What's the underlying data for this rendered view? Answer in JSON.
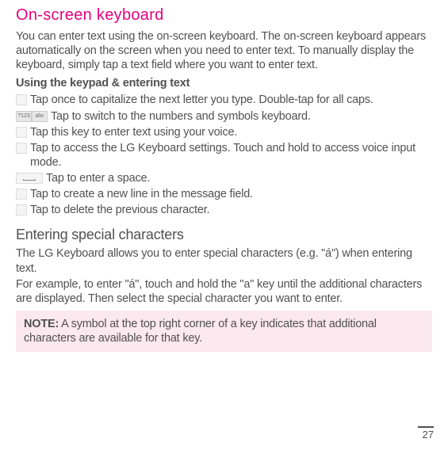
{
  "heading": "On-screen keyboard",
  "intro": "You can enter text using the on-screen keyboard. The on-screen keyboard appears automatically on the screen when you need to enter text. To manually display the keyboard, simply tap a text field where you want to enter text.",
  "subHeading": "Using the keypad & entering text",
  "keys": {
    "caps": " Tap once to capitalize the next letter you type. Double-tap for all caps.",
    "numSym": " Tap to switch to the numbers and symbols keyboard.",
    "voice": " Tap this key to enter text using your voice.",
    "settings": " Tap to access the LG Keyboard settings. Touch and hold to access voice input mode.",
    "space": " Tap to enter a space.",
    "newline": " Tap to create a new line in the message field.",
    "delete": " Tap to delete the previous character."
  },
  "numSymLabels": {
    "left": "?123",
    "right": "abc"
  },
  "section2": {
    "heading": "Entering special characters",
    "p1": "The LG Keyboard allows you to enter special characters (e.g. \"á\") when entering text.",
    "p2": "For example, to enter \"á\", touch and hold the \"a\" key until the additional characters are displayed. Then select the special character you want to enter."
  },
  "note": {
    "label": "NOTE:",
    "text": " A symbol at the top right corner of a key indicates that additional characters are available for that key."
  },
  "pageNumber": "27"
}
